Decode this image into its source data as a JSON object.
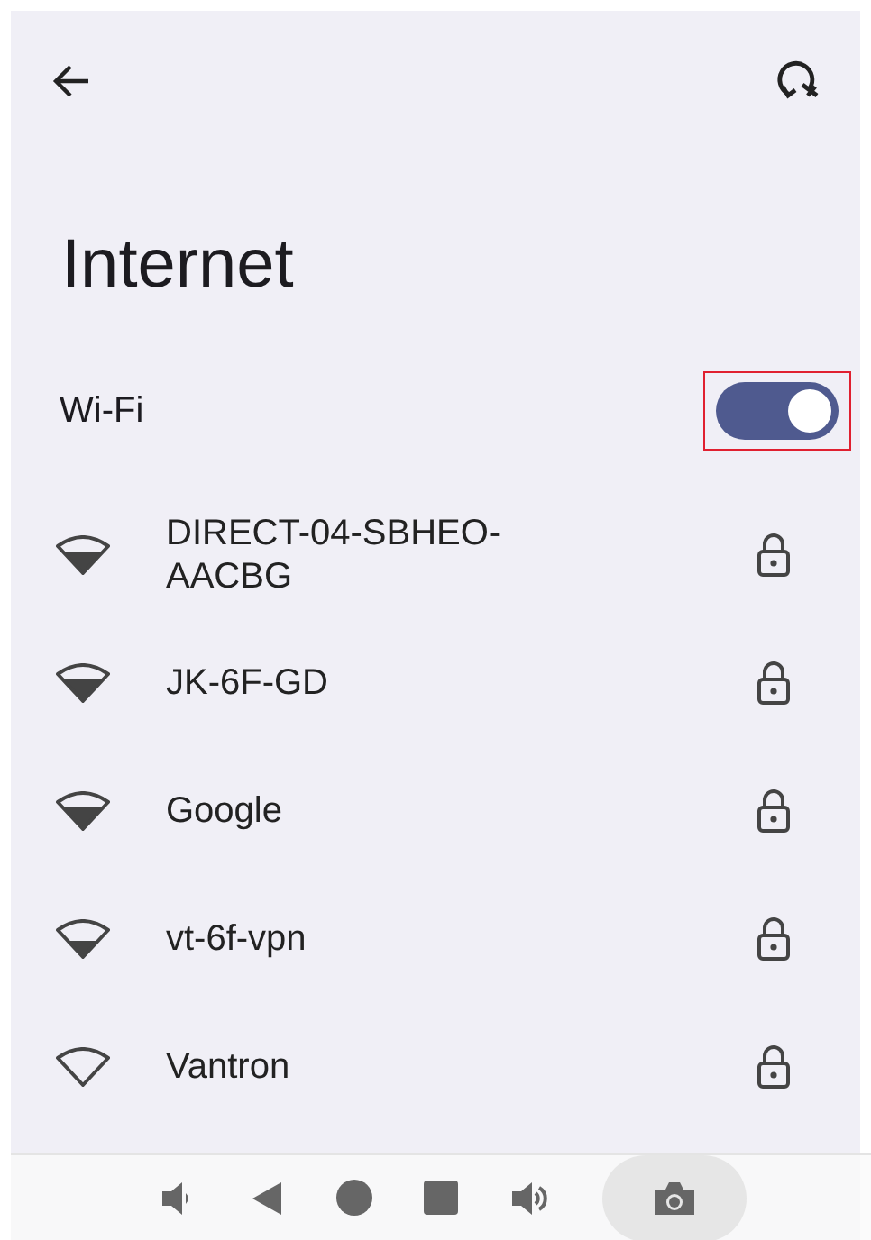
{
  "title": "Internet",
  "wifi": {
    "label": "Wi-Fi",
    "on": true
  },
  "networks": [
    {
      "name": "DIRECT-04-SBHEO-AACBG",
      "kind": "fair",
      "locked": true
    },
    {
      "name": "JK-6F-GD",
      "kind": "fair",
      "locked": true
    },
    {
      "name": "Google",
      "kind": "fair",
      "locked": true
    },
    {
      "name": "vt-6f-vpn",
      "kind": "weak",
      "locked": true
    },
    {
      "name": "Vantron",
      "kind": "empty",
      "locked": true
    }
  ]
}
